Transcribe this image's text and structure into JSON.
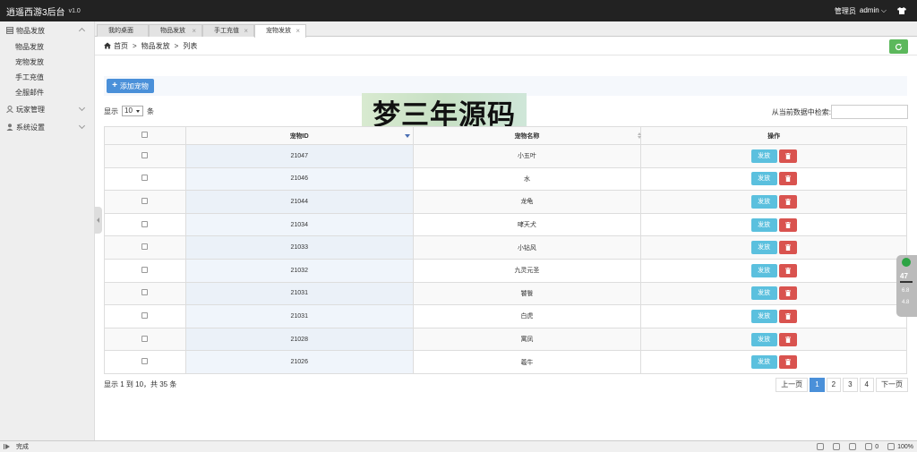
{
  "header": {
    "title": "逍遥西游3后台",
    "version": "v1.0",
    "role": "管理员",
    "user": "admin"
  },
  "sidebar": {
    "groups": [
      {
        "label": "物品发放",
        "expanded": true,
        "items": [
          "物品发放",
          "宠物发放",
          "手工充值",
          "全服邮件"
        ]
      },
      {
        "label": "玩家管理",
        "expanded": false,
        "items": []
      },
      {
        "label": "系统设置",
        "expanded": false,
        "items": []
      }
    ]
  },
  "tabs": [
    {
      "label": "我的桌面",
      "active": false
    },
    {
      "label": "物品发放",
      "active": false
    },
    {
      "label": "手工充值",
      "active": false
    },
    {
      "label": "宠物发放",
      "active": true
    }
  ],
  "breadcrumb": {
    "home": "首页",
    "section": "物品发放",
    "page": "列表"
  },
  "actions": {
    "add_label": "添加宠物"
  },
  "watermark": "梦三年源码",
  "list_controls": {
    "show_prefix": "显示",
    "page_size": "10",
    "show_suffix": "条",
    "search_label": "从当前数据中检索:",
    "search_value": ""
  },
  "table": {
    "headers": {
      "id": "宠物ID",
      "name": "宠物名称",
      "ops": "操作"
    },
    "send_label": "发放",
    "rows": [
      {
        "id": "21047",
        "name": "小五叶"
      },
      {
        "id": "21046",
        "name": "水"
      },
      {
        "id": "21044",
        "name": "龙龟"
      },
      {
        "id": "21034",
        "name": "哮天犬"
      },
      {
        "id": "21033",
        "name": "小钻风"
      },
      {
        "id": "21032",
        "name": "九灵元圣"
      },
      {
        "id": "21031",
        "name": "饕餮"
      },
      {
        "id": "21031",
        "name": "白虎"
      },
      {
        "id": "21028",
        "name": "寓凤"
      },
      {
        "id": "21026",
        "name": "羲牛"
      }
    ]
  },
  "info": "显示 1 到 10，共 35 条",
  "pager": {
    "prev": "上一页",
    "pages": [
      "1",
      "2",
      "3",
      "4"
    ],
    "current": "1",
    "next": "下一页"
  },
  "float_widget": {
    "score": "47",
    "stat1": "6.8",
    "stat2": "4.8"
  },
  "status": {
    "text": "完成",
    "volume": "0",
    "zoom": "100%"
  },
  "colors": {
    "topbar": "#222222",
    "primary": "#4a90d9",
    "info": "#5bc0de",
    "danger": "#d9534f",
    "success": "#5cb85c"
  }
}
